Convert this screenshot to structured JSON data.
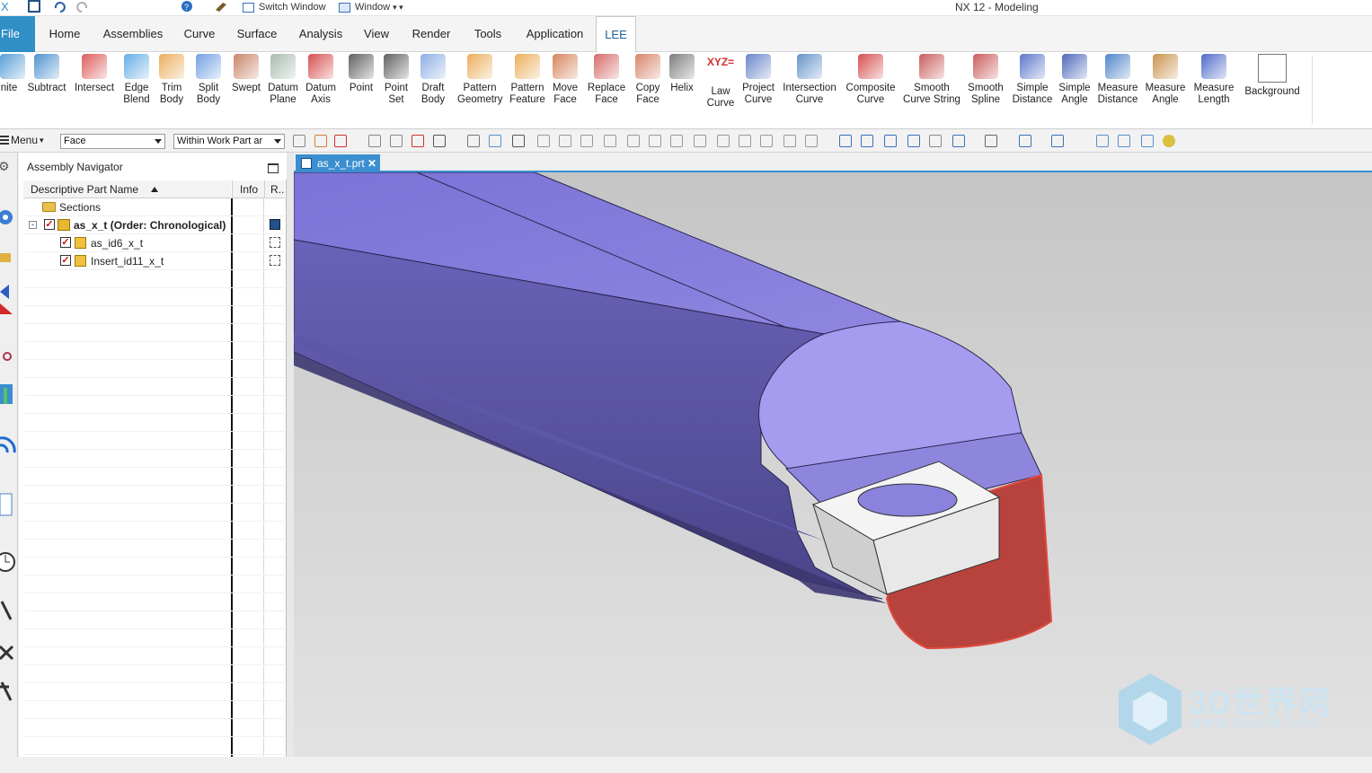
{
  "window": {
    "title": "NX 12 - Modeling"
  },
  "quick_access": {
    "switch_window": "Switch Window",
    "window": "Window"
  },
  "menu_tabs": [
    {
      "label": "File"
    },
    {
      "label": "Home"
    },
    {
      "label": "Assemblies"
    },
    {
      "label": "Curve"
    },
    {
      "label": "Surface"
    },
    {
      "label": "Analysis"
    },
    {
      "label": "View"
    },
    {
      "label": "Render"
    },
    {
      "label": "Tools"
    },
    {
      "label": "Application"
    },
    {
      "label": "LEE"
    }
  ],
  "ribbon": [
    {
      "l1": "nite",
      "l2": "",
      "icon": "unite-icon"
    },
    {
      "l1": "Subtract",
      "l2": "",
      "icon": "subtract-icon"
    },
    {
      "l1": "Intersect",
      "l2": "",
      "icon": "intersect-icon"
    },
    {
      "l1": "Edge",
      "l2": "Blend",
      "icon": "edge-blend-icon"
    },
    {
      "l1": "Trim",
      "l2": "Body",
      "icon": "trim-body-icon"
    },
    {
      "l1": "Split",
      "l2": "Body",
      "icon": "split-body-icon"
    },
    {
      "l1": "Swept",
      "l2": "",
      "icon": "swept-icon"
    },
    {
      "l1": "Datum",
      "l2": "Plane",
      "icon": "datum-plane-icon"
    },
    {
      "l1": "Datum",
      "l2": "Axis",
      "icon": "datum-axis-icon"
    },
    {
      "l1": "Point",
      "l2": "",
      "icon": "point-icon"
    },
    {
      "l1": "Point",
      "l2": "Set",
      "icon": "point-set-icon"
    },
    {
      "l1": "Draft",
      "l2": "Body",
      "icon": "draft-body-icon"
    },
    {
      "l1": "Pattern",
      "l2": "Geometry",
      "icon": "pattern-geometry-icon"
    },
    {
      "l1": "Pattern",
      "l2": "Feature",
      "icon": "pattern-feature-icon"
    },
    {
      "l1": "Move",
      "l2": "Face",
      "icon": "move-face-icon"
    },
    {
      "l1": "Replace",
      "l2": "Face",
      "icon": "replace-face-icon"
    },
    {
      "l1": "Copy",
      "l2": "Face",
      "icon": "copy-face-icon"
    },
    {
      "l1": "Helix",
      "l2": "",
      "icon": "helix-icon"
    },
    {
      "l1": "Law",
      "l2": "Curve",
      "icon": "law-curve-icon",
      "glyph": "XYZ="
    },
    {
      "l1": "Project",
      "l2": "Curve",
      "icon": "project-curve-icon"
    },
    {
      "l1": "Intersection",
      "l2": "Curve",
      "icon": "intersection-curve-icon"
    },
    {
      "l1": "Composite",
      "l2": "Curve",
      "icon": "composite-curve-icon"
    },
    {
      "l1": "Smooth",
      "l2": "Curve String",
      "icon": "smooth-curve-string-icon"
    },
    {
      "l1": "Smooth",
      "l2": "Spline",
      "icon": "smooth-spline-icon"
    },
    {
      "l1": "Simple",
      "l2": "Distance",
      "icon": "simple-distance-icon"
    },
    {
      "l1": "Simple",
      "l2": "Angle",
      "icon": "simple-angle-icon"
    },
    {
      "l1": "Measure",
      "l2": "Distance",
      "icon": "measure-distance-icon"
    },
    {
      "l1": "Measure",
      "l2": "Angle",
      "icon": "measure-angle-icon"
    },
    {
      "l1": "Measure",
      "l2": "Length",
      "icon": "measure-length-icon"
    },
    {
      "l1": "Background",
      "l2": "",
      "icon": "background-icon"
    }
  ],
  "toolbar2": {
    "menu": "Menu",
    "filter": "Face",
    "scope": "Within Work Part ar"
  },
  "navigator": {
    "title": "Assembly Navigator",
    "columns": [
      "Descriptive Part Name",
      "Info",
      "R.."
    ],
    "rows": [
      {
        "name": "Sections"
      },
      {
        "name": "as_x_t (Order: Chronological)"
      },
      {
        "name": "as_id6_x_t"
      },
      {
        "name": "Insert_id11_x_t"
      }
    ]
  },
  "doc_tab": {
    "label": "as_x_t.prt"
  },
  "watermark": {
    "brand": "3D世界网",
    "url": "WWW.3DSJW.COM"
  },
  "colors": {
    "accent": "#2f8fc6",
    "body": "#7b73d6",
    "highlight": "#b8423c"
  }
}
